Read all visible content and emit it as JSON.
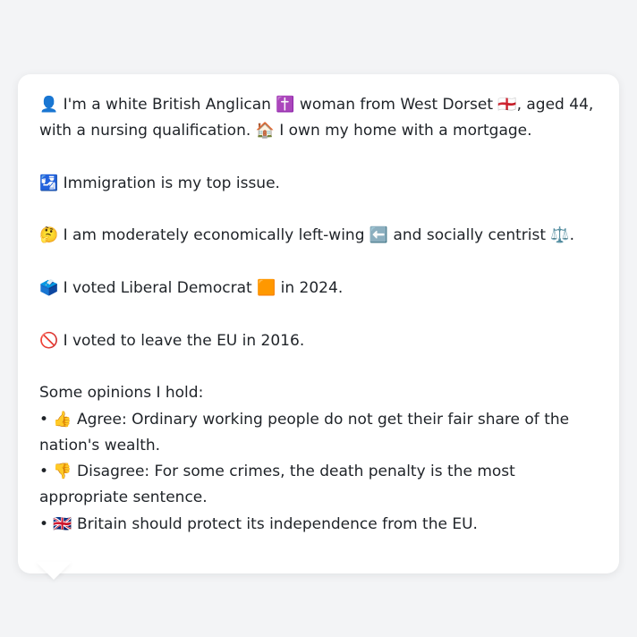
{
  "bio": {
    "line1": "👤 I'm a white British Anglican ✝️ woman from West Dorset 🏴󠁧󠁢󠁥󠁮󠁧󠁿, aged 44, with a nursing qualification. 🏠 I own my home with a mortgage."
  },
  "top_issue": "🛂 Immigration is my top issue.",
  "ideology": "🤔 I am moderately economically left-wing ⬅️ and socially centrist ⚖️.",
  "vote_2024": "🗳️ I voted Liberal Democrat 🟧 in 2024.",
  "eu_vote": "🚫 I voted to leave the EU in 2016.",
  "opinions": {
    "heading": "Some opinions I hold:",
    "items": [
      "• 👍 Agree: Ordinary working people do not get their fair share of the nation's wealth.",
      "• 👎 Disagree: For some crimes, the death penalty is the most appropriate sentence.",
      "• 🇬🇧 Britain should protect its independence from the EU."
    ]
  }
}
